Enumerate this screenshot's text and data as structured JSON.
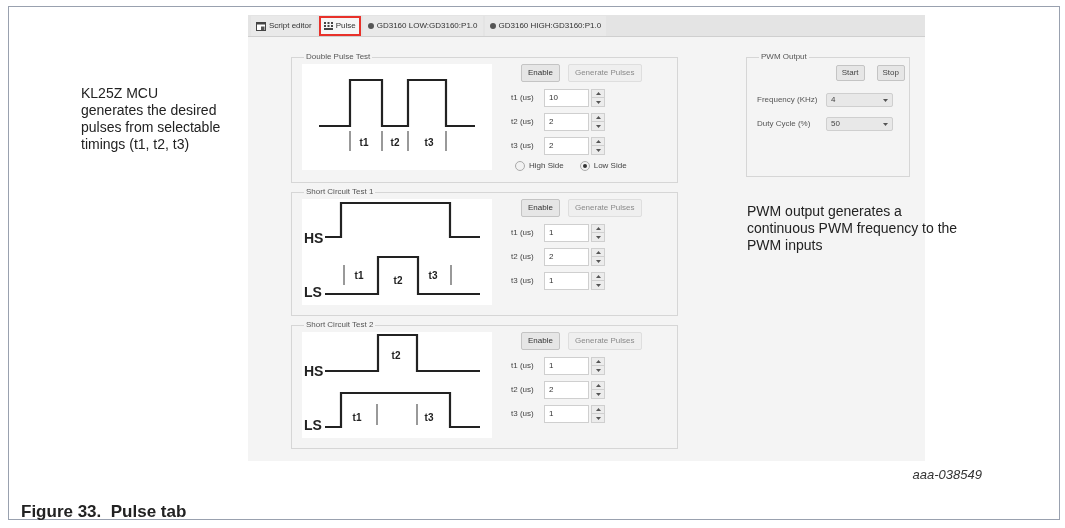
{
  "left_note": {
    "lines": [
      "KL25Z MCU",
      "generates the desired",
      "pulses from selectable",
      "timings (t1, t2, t3)"
    ]
  },
  "tabs": [
    {
      "label": "Script editor",
      "kind": "editor",
      "selected": false,
      "callout": false
    },
    {
      "label": "Pulse",
      "kind": "pulse",
      "selected": true,
      "callout": true
    },
    {
      "label": "GD3160 LOW:GD3160:P1.0",
      "kind": "device",
      "selected": false,
      "callout": false
    },
    {
      "label": "GD3160 HIGH:GD3160:P1.0",
      "kind": "device",
      "selected": false,
      "callout": false
    }
  ],
  "panels": [
    {
      "title": "Double Pulse Test",
      "diagram": {
        "kind": "double_pulse",
        "labels": [
          "t1",
          "t2",
          "t3"
        ]
      },
      "enable": "Enable",
      "generate": {
        "label": "Generate Pulses",
        "disabled": true
      },
      "fields": [
        {
          "label": "t1 (us)",
          "value": "10"
        },
        {
          "label": "t2 (us)",
          "value": "2"
        },
        {
          "label": "t3 (us)",
          "value": "2"
        }
      ],
      "radios": [
        {
          "label": "High Side",
          "selected": false
        },
        {
          "label": "Low Side",
          "selected": true
        }
      ]
    },
    {
      "title": "Short Circuit Test 1",
      "diagram": {
        "kind": "short_circuit_1",
        "labels": [
          "HS",
          "LS",
          "t1",
          "t2",
          "t3"
        ]
      },
      "enable": "Enable",
      "generate": {
        "label": "Generate Pulses",
        "disabled": true
      },
      "fields": [
        {
          "label": "t1 (us)",
          "value": "1"
        },
        {
          "label": "t2 (us)",
          "value": "2"
        },
        {
          "label": "t3 (us)",
          "value": "1"
        }
      ]
    },
    {
      "title": "Short Circuit Test 2",
      "diagram": {
        "kind": "short_circuit_2",
        "labels": [
          "HS",
          "LS",
          "t2",
          "t1",
          "t3"
        ]
      },
      "enable": "Enable",
      "generate": {
        "label": "Generate Pulses",
        "disabled": true
      },
      "fields": [
        {
          "label": "t1 (us)",
          "value": "1"
        },
        {
          "label": "t2 (us)",
          "value": "2"
        },
        {
          "label": "t3 (us)",
          "value": "1"
        }
      ]
    }
  ],
  "pwm": {
    "title": "PWM Output",
    "buttons": [
      "Start",
      "Stop"
    ],
    "dropdowns": [
      {
        "label": "Frequency (KHz)",
        "value": "4"
      },
      {
        "label": "Duty Cycle (%)",
        "value": "50"
      }
    ]
  },
  "right_note": {
    "lines": [
      "PWM output generates a",
      "continuous PWM frequency to the",
      "PWM inputs"
    ]
  },
  "figure_id": "aaa-038549",
  "caption": "Figure 33.  Pulse tab"
}
